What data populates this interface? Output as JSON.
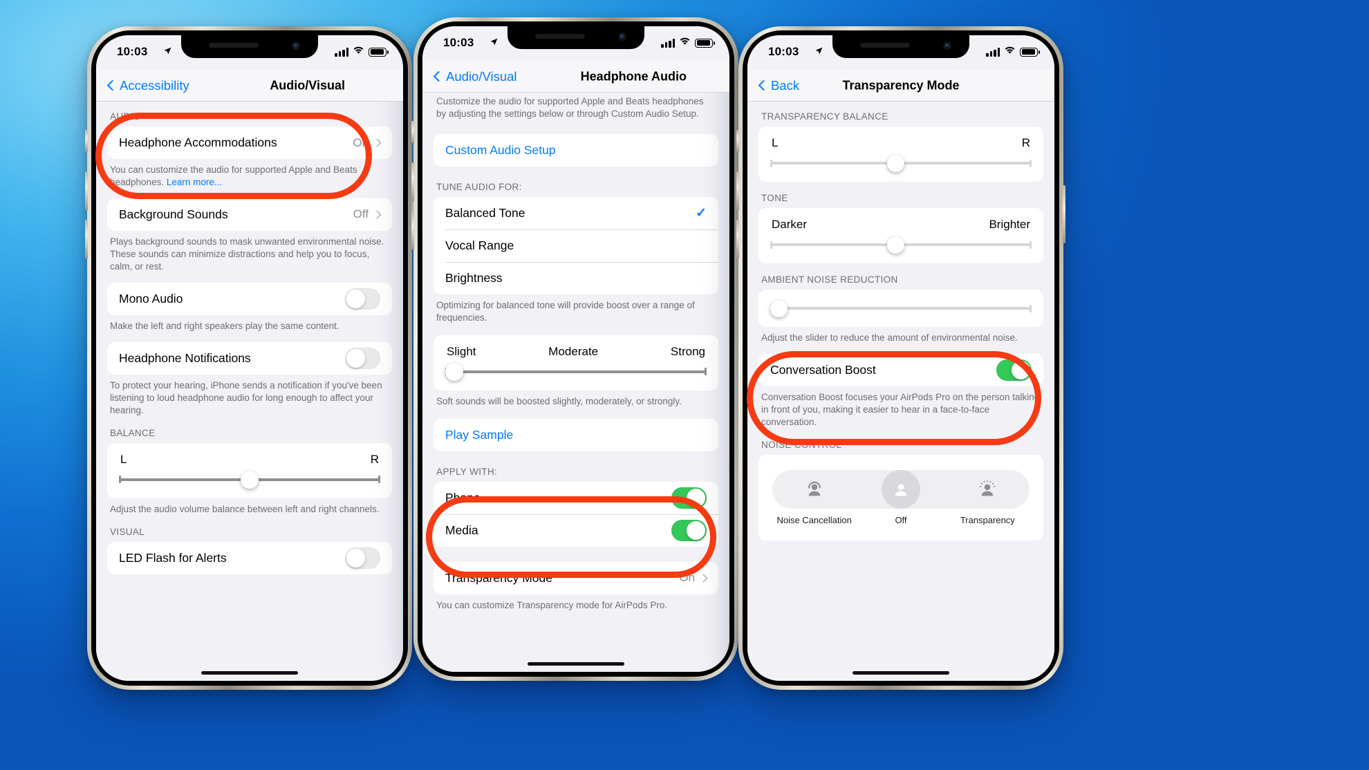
{
  "background": {
    "accent": "#1f8fe0"
  },
  "annotation_color": "#f63a12",
  "phones": [
    {
      "id": "phone-accessibility-audiovisual",
      "status": {
        "time": "10:03",
        "location_icon": "location-arrow-icon",
        "signal": "cellular-bars-icon",
        "wifi": "wifi-icon",
        "battery": "battery-full-icon"
      },
      "nav": {
        "back_label": "Accessibility",
        "title": "Audio/Visual"
      },
      "sections": [
        {
          "header": "AUDIO"
        },
        {
          "row": {
            "label": "Headphone Accommodations",
            "value": "On",
            "chevron": true
          }
        },
        {
          "footnote": "You can customize the audio for supported Apple and Beats headphones. ",
          "footnote_link": "Learn more..."
        },
        {
          "row": {
            "label": "Background Sounds",
            "value": "Off",
            "chevron": true
          }
        },
        {
          "footnote": "Plays background sounds to mask unwanted environmental noise. These sounds can minimize distractions and help you to focus, calm, or rest."
        },
        {
          "row": {
            "label": "Mono Audio",
            "toggle": "off"
          }
        },
        {
          "footnote": "Make the left and right speakers play the same content."
        },
        {
          "row": {
            "label": "Headphone Notifications",
            "toggle": "off"
          }
        },
        {
          "footnote": "To protect your hearing, iPhone sends a notification if you've been listening to loud headphone audio for long enough to affect your hearing."
        },
        {
          "header": "BALANCE"
        },
        {
          "slider": {
            "left_label": "L",
            "right_label": "R",
            "value_pct": 50
          }
        },
        {
          "footnote": "Adjust the audio volume balance between left and right channels."
        },
        {
          "header": "VISUAL"
        },
        {
          "row": {
            "label": "LED Flash for Alerts",
            "toggle": "off"
          }
        }
      ]
    },
    {
      "id": "phone-headphone-audio",
      "status": {
        "time": "10:03",
        "location_icon": "location-arrow-icon",
        "signal": "cellular-bars-icon",
        "wifi": "wifi-icon",
        "battery": "battery-full-icon"
      },
      "nav": {
        "back_label": "Audio/Visual",
        "title": "Headphone Audio"
      },
      "top_footnote": "Customize the audio for supported Apple and Beats headphones by adjusting the settings below or through Custom Audio Setup.",
      "custom_audio_setup_label": "Custom Audio Setup",
      "tune_header": "TUNE AUDIO FOR:",
      "tune_options": [
        {
          "label": "Balanced Tone",
          "selected": true
        },
        {
          "label": "Vocal Range",
          "selected": false
        },
        {
          "label": "Brightness",
          "selected": false
        }
      ],
      "tune_footnote": "Optimizing for balanced tone will provide boost over a range of frequencies.",
      "strength_labels": [
        "Slight",
        "Moderate",
        "Strong"
      ],
      "strength_value_pct": 2,
      "strength_footnote": "Soft sounds will be boosted slightly, moderately, or strongly.",
      "play_sample_label": "Play Sample",
      "apply_header": "APPLY WITH:",
      "apply_rows": [
        {
          "label": "Phone",
          "toggle": "on"
        },
        {
          "label": "Media",
          "toggle": "on"
        }
      ],
      "transparency_row": {
        "label": "Transparency Mode",
        "value": "On",
        "chevron": true
      },
      "transparency_footnote": "You can customize Transparency mode for AirPods Pro."
    },
    {
      "id": "phone-transparency-mode",
      "status": {
        "time": "10:03",
        "location_icon": "location-arrow-icon",
        "signal": "cellular-bars-icon",
        "wifi": "wifi-icon",
        "battery": "battery-full-icon"
      },
      "nav": {
        "back_label": "Back",
        "title": "Transparency Mode"
      },
      "balance_header": "TRANSPARENCY BALANCE",
      "balance_slider": {
        "left_label": "L",
        "right_label": "R",
        "value_pct": 48
      },
      "tone_header": "TONE",
      "tone_slider": {
        "left_label": "Darker",
        "right_label": "Brighter",
        "value_pct": 48
      },
      "anr_header": "AMBIENT NOISE REDUCTION",
      "anr_slider": {
        "value_pct": 3
      },
      "anr_footnote": "Adjust the slider to reduce the amount of environmental noise.",
      "conversation_boost": {
        "label": "Conversation Boost",
        "toggle": "on"
      },
      "conversation_footnote": "Conversation Boost focuses your AirPods Pro on the person talking in front of you, making it easier to hear in a face-to-face conversation.",
      "noise_header": "NOISE CONTROL",
      "noise_options": [
        {
          "label": "Noise Cancellation",
          "icon": "noise-cancellation-icon",
          "selected": false
        },
        {
          "label": "Off",
          "icon": "noise-off-icon",
          "selected": true
        },
        {
          "label": "Transparency",
          "icon": "transparency-icon",
          "selected": false
        }
      ]
    }
  ]
}
